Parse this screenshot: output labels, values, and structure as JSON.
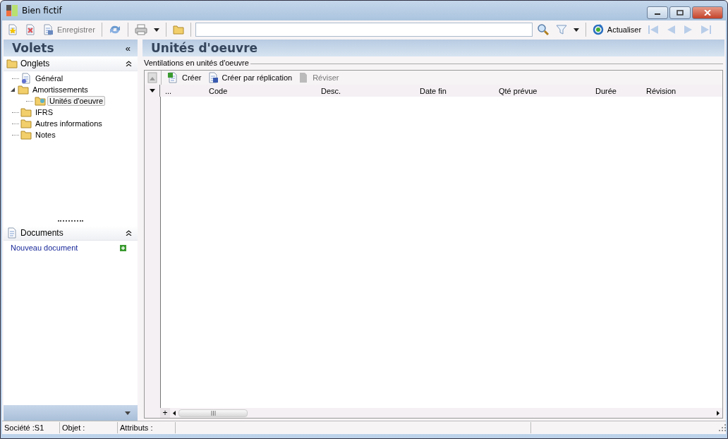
{
  "window": {
    "title": "Bien fictif"
  },
  "toolbar": {
    "save": {
      "label": "Enregistrer",
      "disabled": true
    },
    "refresh": {
      "label": "Actualiser",
      "disabled": false
    },
    "nav_disabled": true
  },
  "sidebar": {
    "title": "Volets",
    "collapse_glyph": "«",
    "sections": [
      {
        "title": "Onglets",
        "expanded": true,
        "tree": [
          {
            "label": "Général",
            "selected": false
          },
          {
            "label": "Amortissements",
            "selected": false,
            "expanded": true,
            "children": [
              {
                "label": "Unités d'oeuvre",
                "selected": true
              }
            ]
          },
          {
            "label": "IFRS",
            "selected": false
          },
          {
            "label": "Autres informations",
            "selected": false
          },
          {
            "label": "Notes",
            "selected": false
          }
        ]
      },
      {
        "title": "Documents",
        "expanded": true,
        "link": "Nouveau document"
      }
    ]
  },
  "main": {
    "title": "Unités d'oeuvre",
    "group_label": "Ventilations en unités d'oeuvre",
    "grid_actions": [
      {
        "label": "Créer",
        "disabled": false
      },
      {
        "label": "Créer par réplication",
        "disabled": false
      },
      {
        "label": "Réviser",
        "disabled": true
      }
    ],
    "columns": [
      "...",
      "Code",
      "Desc.",
      "Date fin",
      "Qté prévue",
      "Durée",
      "Révision"
    ],
    "footer_button": "+"
  },
  "status_bar": [
    "Société :S1",
    "Objet :",
    "Attributs :"
  ]
}
